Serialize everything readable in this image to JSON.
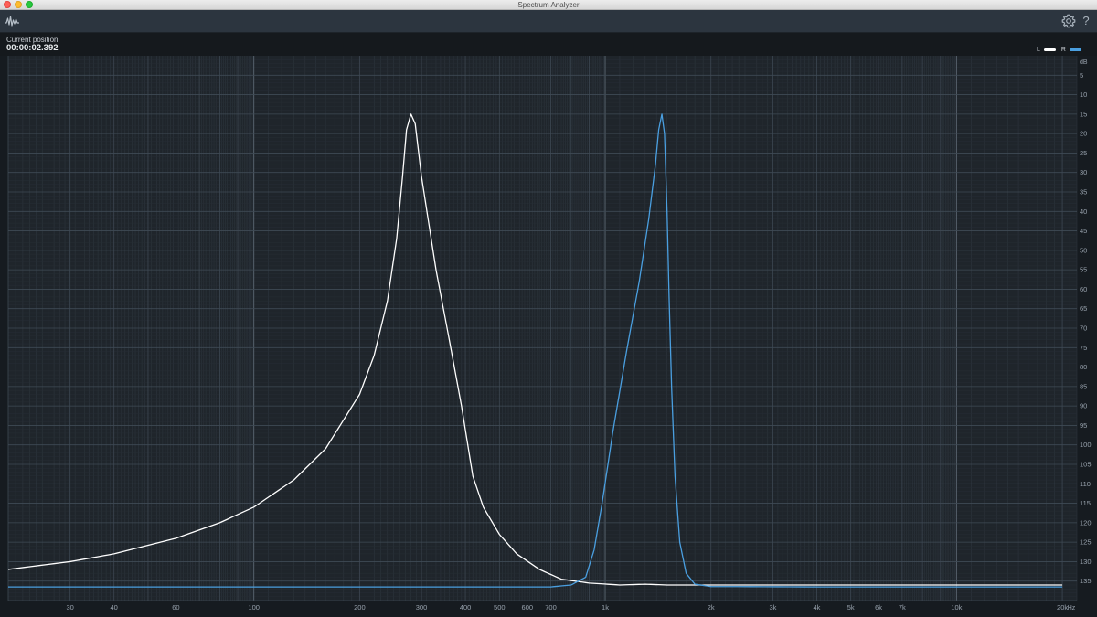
{
  "window": {
    "title": "Spectrum Analyzer"
  },
  "toolbar": {
    "app_icon": "waveform-icon",
    "settings_icon": "gear-icon",
    "help_label": "?"
  },
  "position": {
    "label": "Current position",
    "value": "00:00:02.392"
  },
  "legend": [
    {
      "label": "L",
      "color": "#ffffff"
    },
    {
      "label": "R",
      "color": "#4a9fe0"
    }
  ],
  "chart_data": {
    "type": "line",
    "xscale": "log",
    "xlim": [
      20,
      22000
    ],
    "ylim": [
      0,
      140
    ],
    "yaxis_inverted": true,
    "xunit": "Hz",
    "yunit": "dB",
    "grid": true,
    "x_ticks": [
      {
        "value": 30,
        "label": "30"
      },
      {
        "value": 40,
        "label": "40"
      },
      {
        "value": 60,
        "label": "60"
      },
      {
        "value": 100,
        "label": "100"
      },
      {
        "value": 200,
        "label": "200"
      },
      {
        "value": 300,
        "label": "300"
      },
      {
        "value": 400,
        "label": "400"
      },
      {
        "value": 500,
        "label": "500"
      },
      {
        "value": 600,
        "label": "600"
      },
      {
        "value": 700,
        "label": "700"
      },
      {
        "value": 1000,
        "label": "1k"
      },
      {
        "value": 2000,
        "label": "2k"
      },
      {
        "value": 3000,
        "label": "3k"
      },
      {
        "value": 4000,
        "label": "4k"
      },
      {
        "value": 5000,
        "label": "5k"
      },
      {
        "value": 6000,
        "label": "6k"
      },
      {
        "value": 7000,
        "label": "7k"
      },
      {
        "value": 10000,
        "label": "10k"
      },
      {
        "value": 20000,
        "label": "20k"
      }
    ],
    "y_ticks": [
      {
        "value": 5,
        "label": "5"
      },
      {
        "value": 10,
        "label": "10"
      },
      {
        "value": 15,
        "label": "15"
      },
      {
        "value": 20,
        "label": "20"
      },
      {
        "value": 25,
        "label": "25"
      },
      {
        "value": 30,
        "label": "30"
      },
      {
        "value": 35,
        "label": "35"
      },
      {
        "value": 40,
        "label": "40"
      },
      {
        "value": 45,
        "label": "45"
      },
      {
        "value": 50,
        "label": "50"
      },
      {
        "value": 55,
        "label": "55"
      },
      {
        "value": 60,
        "label": "60"
      },
      {
        "value": 65,
        "label": "65"
      },
      {
        "value": 70,
        "label": "70"
      },
      {
        "value": 75,
        "label": "75"
      },
      {
        "value": 80,
        "label": "80"
      },
      {
        "value": 85,
        "label": "85"
      },
      {
        "value": 90,
        "label": "90"
      },
      {
        "value": 95,
        "label": "95"
      },
      {
        "value": 100,
        "label": "100"
      },
      {
        "value": 105,
        "label": "105"
      },
      {
        "value": 110,
        "label": "110"
      },
      {
        "value": 115,
        "label": "115"
      },
      {
        "value": 120,
        "label": "120"
      },
      {
        "value": 125,
        "label": "125"
      },
      {
        "value": 130,
        "label": "130"
      },
      {
        "value": 135,
        "label": "135"
      }
    ],
    "y_unit_label": "dB",
    "x_unit_label": "Hz",
    "series": [
      {
        "name": "L",
        "color": "#ffffff",
        "points": [
          [
            20,
            132
          ],
          [
            30,
            130
          ],
          [
            40,
            128
          ],
          [
            60,
            124
          ],
          [
            80,
            120
          ],
          [
            100,
            116
          ],
          [
            130,
            109
          ],
          [
            160,
            101
          ],
          [
            200,
            87
          ],
          [
            220,
            77
          ],
          [
            240,
            63
          ],
          [
            255,
            47
          ],
          [
            265,
            31
          ],
          [
            272,
            19
          ],
          [
            280,
            15
          ],
          [
            288,
            17.5
          ],
          [
            300,
            31
          ],
          [
            330,
            55
          ],
          [
            360,
            73
          ],
          [
            390,
            90
          ],
          [
            420,
            108
          ],
          [
            450,
            116
          ],
          [
            500,
            123
          ],
          [
            560,
            128
          ],
          [
            650,
            132
          ],
          [
            750,
            134.5
          ],
          [
            900,
            135.5
          ],
          [
            1100,
            136
          ],
          [
            1300,
            135.8
          ],
          [
            1500,
            136
          ],
          [
            2000,
            136
          ],
          [
            4000,
            136
          ],
          [
            10000,
            136
          ],
          [
            20000,
            136
          ]
        ]
      },
      {
        "name": "R",
        "color": "#4a9fe0",
        "points": [
          [
            20,
            136.5
          ],
          [
            700,
            136.5
          ],
          [
            800,
            136
          ],
          [
            880,
            134
          ],
          [
            930,
            127
          ],
          [
            980,
            115
          ],
          [
            1050,
            97
          ],
          [
            1150,
            76
          ],
          [
            1250,
            58
          ],
          [
            1330,
            42
          ],
          [
            1390,
            28
          ],
          [
            1420,
            19
          ],
          [
            1450,
            15
          ],
          [
            1475,
            20
          ],
          [
            1500,
            40
          ],
          [
            1520,
            62
          ],
          [
            1545,
            85
          ],
          [
            1580,
            108
          ],
          [
            1630,
            125
          ],
          [
            1700,
            133
          ],
          [
            1800,
            135.8
          ],
          [
            2000,
            136.4
          ],
          [
            4000,
            136.5
          ],
          [
            10000,
            136.5
          ],
          [
            20000,
            136.5
          ]
        ]
      }
    ]
  }
}
